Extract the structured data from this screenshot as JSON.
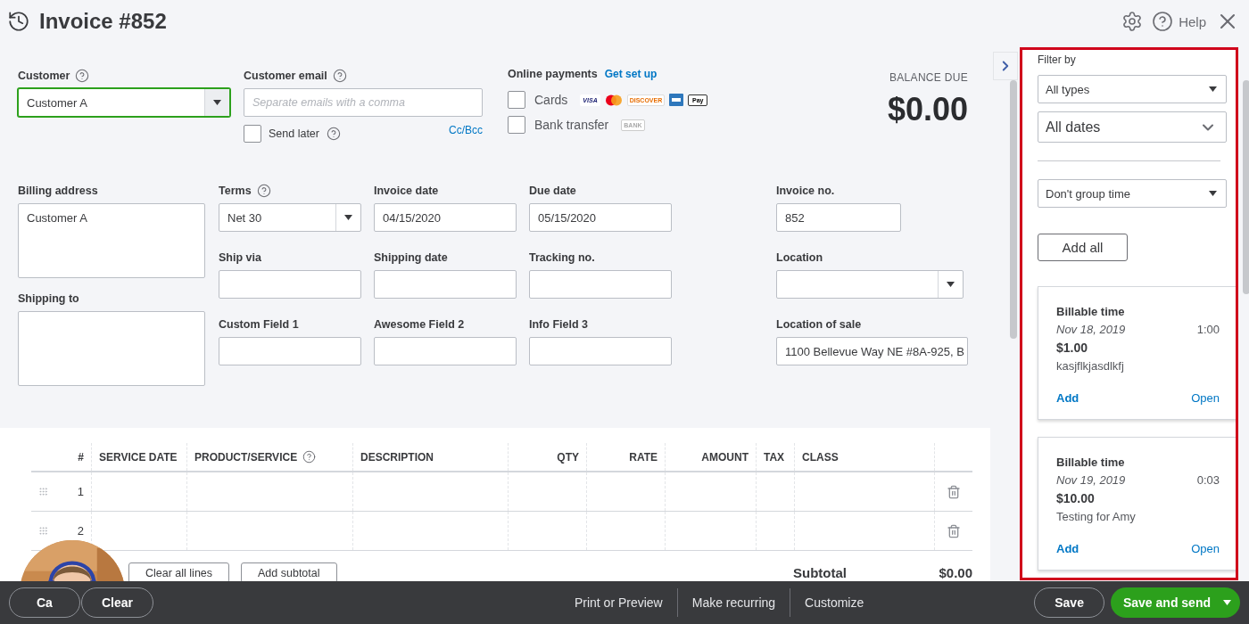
{
  "header": {
    "title": "Invoice #852",
    "help": "Help"
  },
  "customer": {
    "label": "Customer",
    "value": "Customer A",
    "help": true
  },
  "customer_email": {
    "label": "Customer email",
    "placeholder": "Separate emails with a comma",
    "help": true
  },
  "send_later": {
    "label": "Send later",
    "checked": false,
    "help": true
  },
  "cc_bcc": "Cc/Bcc",
  "online_payments": {
    "label": "Online payments",
    "link": "Get set up",
    "options": [
      {
        "label": "Cards",
        "checked": false,
        "logos": [
          {
            "kind": "visa",
            "text": "VISA"
          },
          {
            "kind": "mastercard"
          },
          {
            "kind": "discover",
            "text": "DISCOVER"
          },
          {
            "kind": "amex"
          },
          {
            "kind": "applepay",
            "text": "Pay"
          }
        ]
      },
      {
        "label": "Bank transfer",
        "checked": false,
        "logos": [
          {
            "kind": "bank",
            "text": "BANK"
          }
        ]
      }
    ]
  },
  "balance": {
    "label": "BALANCE DUE",
    "amount": "$0.00"
  },
  "addresses": [
    {
      "label": "Billing address",
      "value": "Customer A"
    },
    {
      "label": "Shipping to"
    }
  ],
  "fields": [
    {
      "label": "Terms",
      "kind": "select",
      "value": "Net 30",
      "help": true
    },
    {
      "label": "Invoice date",
      "kind": "text",
      "value": "04/15/2020",
      "help": false
    },
    {
      "label": "Due date",
      "kind": "text",
      "value": "05/15/2020",
      "help": false
    },
    {
      "label": "Ship via",
      "kind": "text",
      "help": false
    },
    {
      "label": "Shipping date",
      "kind": "text",
      "help": false
    },
    {
      "label": "Tracking no.",
      "kind": "text",
      "help": false
    },
    {
      "label": "Custom Field 1",
      "kind": "text",
      "help": false
    },
    {
      "label": "Awesome Field 2",
      "kind": "text",
      "help": false
    },
    {
      "label": "Info Field 3",
      "kind": "text",
      "help": false
    }
  ],
  "right_fields": [
    {
      "label": "Invoice no.",
      "kind": "text",
      "value": "852"
    },
    {
      "label": "Location",
      "kind": "select"
    },
    {
      "label": "Location of sale",
      "kind": "text",
      "value": "1100 Bellevue Way NE #8A-925, B"
    }
  ],
  "table": {
    "columns": [
      {
        "label": "#",
        "help": false
      },
      {
        "label": "SERVICE DATE",
        "help": false
      },
      {
        "label": "PRODUCT/SERVICE",
        "help": true
      },
      {
        "label": "DESCRIPTION",
        "help": false
      },
      {
        "label": "QTY",
        "help": false
      },
      {
        "label": "RATE",
        "help": false
      },
      {
        "label": "AMOUNT",
        "help": false
      },
      {
        "label": "TAX",
        "help": false
      },
      {
        "label": "CLASS",
        "help": false
      }
    ],
    "rows": [
      {
        "number": "1"
      },
      {
        "number": "2"
      }
    ]
  },
  "table_buttons": [
    "Clear all lines",
    "Add subtotal"
  ],
  "subtotal": {
    "label": "Subtotal",
    "value": "$0.00"
  },
  "sidebar": {
    "filter_label": "Filter by",
    "filters": [
      {
        "kind": "select",
        "value": "All types"
      },
      {
        "kind": "dropdown",
        "value": "All dates"
      },
      {
        "kind": "select",
        "value": "Don't group time"
      }
    ],
    "add_all": "Add all",
    "items": [
      {
        "title": "Billable time",
        "date": "Nov 18, 2019",
        "duration": "1:00",
        "amount": "$1.00",
        "description": "kasjflkjasdlkfj",
        "add": "Add",
        "open": "Open"
      },
      {
        "title": "Billable time",
        "date": "Nov 19, 2019",
        "duration": "0:03",
        "amount": "$10.00",
        "description": "Testing for Amy",
        "add": "Add",
        "open": "Open"
      }
    ]
  },
  "footer": {
    "left_buttons": [
      "Ca",
      "Clear"
    ],
    "links": [
      "Print or Preview",
      "Make recurring",
      "Customize"
    ],
    "save": "Save",
    "save_and_send": "Save and send"
  },
  "webcam": {
    "kind": "picture"
  }
}
